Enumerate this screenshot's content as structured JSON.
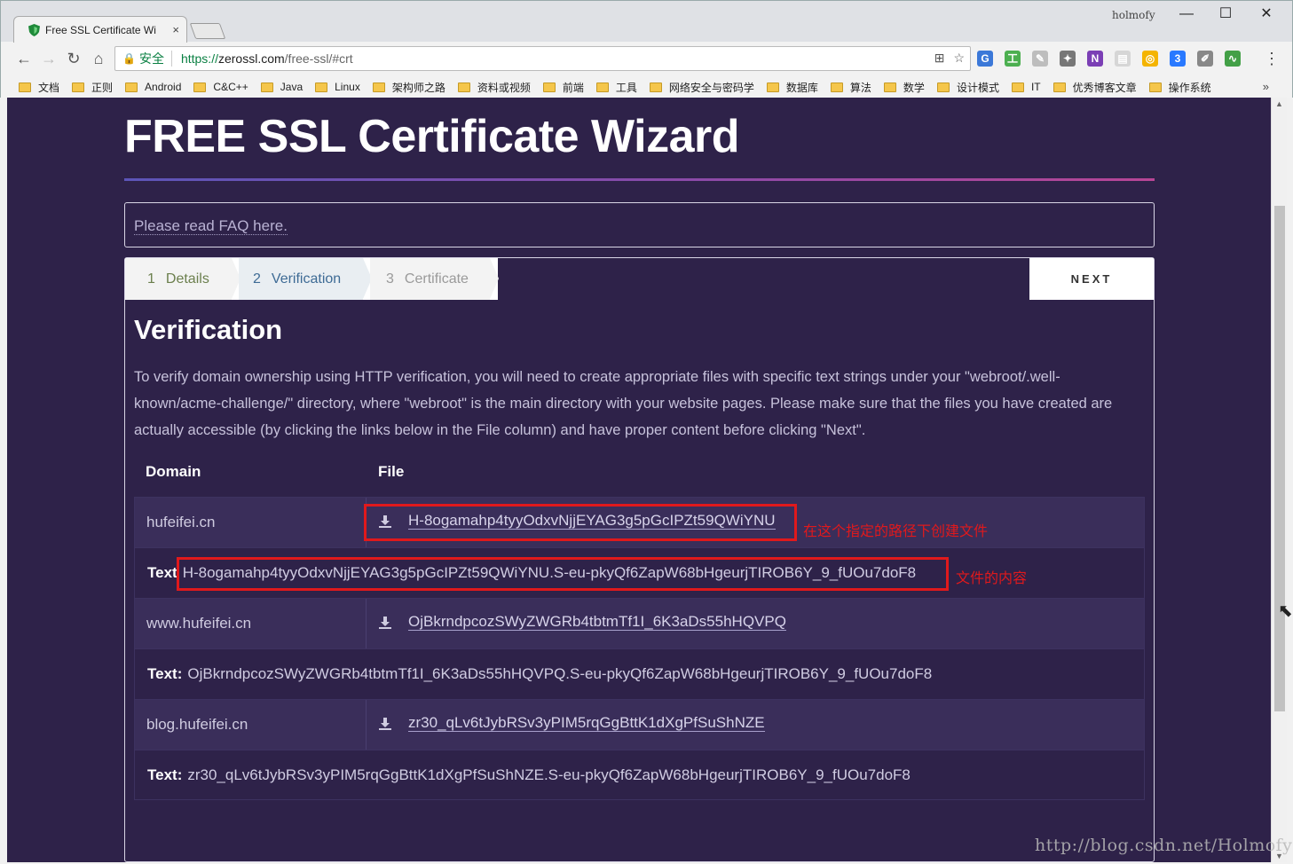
{
  "browser": {
    "tab_title": "Free SSL Certificate Wi",
    "tab_close": "×",
    "profile_name": "holmofy",
    "window_controls": {
      "minimize": "—",
      "maximize": "☐",
      "close": "✕"
    },
    "secure_label": "安全",
    "url": {
      "scheme": "https://",
      "host": "zerossl.com",
      "path": "/free-ssl/#crt"
    },
    "bookmarks": [
      "文档",
      "正则",
      "Android",
      "C&C++",
      "Java",
      "Linux",
      "架构师之路",
      "资料或视频",
      "前端",
      "工具",
      "网络安全与密码学",
      "数据库",
      "算法",
      "数学",
      "设计模式",
      "IT",
      "优秀博客文章",
      "操作系统"
    ],
    "bookmarks_more": "»"
  },
  "page": {
    "title": "FREE SSL Certificate Wizard",
    "faq_link": "Please read FAQ here.",
    "steps": [
      {
        "num": "1",
        "label": "Details"
      },
      {
        "num": "2",
        "label": "Verification"
      },
      {
        "num": "3",
        "label": "Certificate"
      }
    ],
    "next_label": "NEXT",
    "heading": "Verification",
    "description": "To verify domain ownership using HTTP verification, you will need to create appropriate files with specific text strings under your \"webroot/.well-known/acme-challenge/\" directory, where \"webroot\" is the main directory with your website pages. Please make sure that the files you have created are actually accessible (by clicking the links below in the File column) and have proper content before clicking \"Next\".",
    "table": {
      "headers": {
        "domain": "Domain",
        "file": "File"
      },
      "text_label": "Text:",
      "text_label_first": "Text",
      "rows": [
        {
          "domain": "hufeifei.cn",
          "file": "H-8ogamahp4tyyOdxvNjjEYAG3g5pGcIPZt59QWiYNU",
          "text": "H-8ogamahp4tyyOdxvNjjEYAG3g5pGcIPZt59QWiYNU.S-eu-pkyQf6ZapW68bHgeurjTIROB6Y_9_fUOu7doF8"
        },
        {
          "domain": "www.hufeifei.cn",
          "file": "OjBkrndpcozSWyZWGRb4tbtmTf1I_6K3aDs55hHQVPQ",
          "text": "OjBkrndpcozSWyZWGRb4tbtmTf1I_6K3aDs55hHQVPQ.S-eu-pkyQf6ZapW68bHgeurjTIROB6Y_9_fUOu7doF8"
        },
        {
          "domain": "blog.hufeifei.cn",
          "file": "zr30_qLv6tJybRSv3yPIM5rqGgBttK1dXgPfSuShNZE",
          "text": "zr30_qLv6tJybRSv3yPIM5rqGgBttK1dXgPfSuShNZE.S-eu-pkyQf6ZapW68bHgeurjTIROB6Y_9_fUOu7doF8"
        }
      ]
    }
  },
  "annotations": {
    "file_note": "在这个指定的路径下创建文件",
    "content_note": "文件的内容"
  },
  "watermark": "http://blog.csdn.net/Holmofy",
  "colors": {
    "page_bg": "#2e2249",
    "annotation_red": "#e0191c",
    "title_rule_start": "#5c55b8",
    "title_rule_end": "#b84696"
  }
}
